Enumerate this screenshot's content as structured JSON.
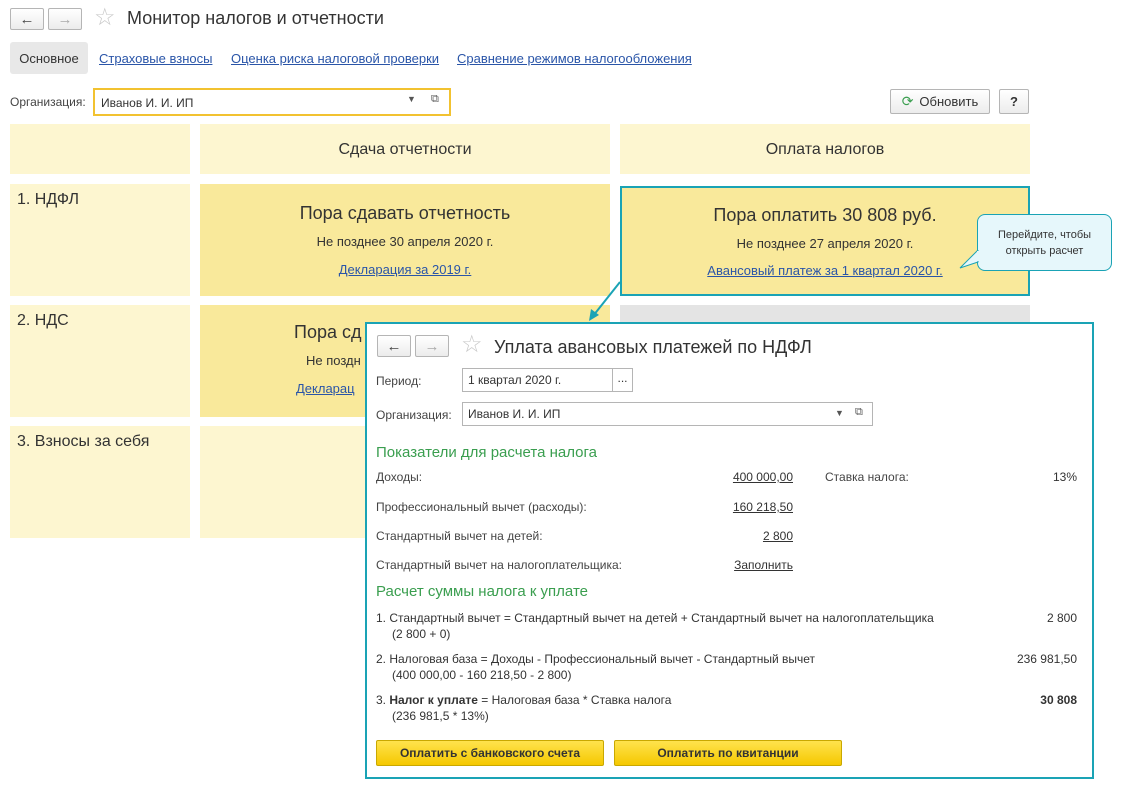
{
  "window": {
    "title": "Монитор налогов и отчетности"
  },
  "tabs": [
    {
      "label": "Основное"
    },
    {
      "label": "Страховые взносы"
    },
    {
      "label": "Оценка риска налоговой проверки"
    },
    {
      "label": "Сравнение режимов налогообложения"
    }
  ],
  "org": {
    "label": "Организация:",
    "value": "Иванов И. И. ИП"
  },
  "toolbar": {
    "refresh_label": "Обновить",
    "help_label": "?"
  },
  "columns": {
    "reporting": "Сдача отчетности",
    "payment": "Оплата налогов"
  },
  "rows": [
    {
      "label": "1. НДФЛ"
    },
    {
      "label": "2. НДС"
    },
    {
      "label": "3. Взносы за себя"
    }
  ],
  "ndfl_report": {
    "title": "Пора сдавать отчетность",
    "deadline": "Не позднее 30 апреля 2020 г.",
    "link": "Декларация за 2019 г."
  },
  "ndfl_pay": {
    "title": "Пора оплатить 30 808 руб.",
    "deadline": "Не позднее 27 апреля 2020 г.",
    "link": "Авансовый платеж за 1 квартал 2020 г."
  },
  "nds_report": {
    "title_partial": "Пора сд",
    "deadline_partial": "Не поздн",
    "link_partial": "Декларац"
  },
  "tooltip": {
    "text": "Перейдите, чтобы открыть расчет"
  },
  "popup": {
    "title": "Уплата авансовых платежей по НДФЛ",
    "period_label": "Период:",
    "period_value": "1 квартал 2020 г.",
    "period_btn": "...",
    "org_label": "Организация:",
    "org_value": "Иванов И. И. ИП",
    "section1": "Показатели для расчета налога",
    "income_label": "Доходы:",
    "income_value": "400 000,00",
    "rate_label": "Ставка налога:",
    "rate_value": "13%",
    "prof_label": "Профессиональный вычет (расходы):",
    "prof_value": "160 218,50",
    "child_label": "Стандартный вычет на детей:",
    "child_value": "2 800",
    "payer_label": "Стандартный вычет на налогоплательщика:",
    "payer_link": "Заполнить",
    "section2": "Расчет суммы налога к уплате",
    "calc": [
      {
        "line": "1. Стандартный вычет = Стандартный вычет на детей + Стандартный вычет на налогоплательщика",
        "detail": "(2 800 + 0)",
        "value": "2 800"
      },
      {
        "line": "2. Налоговая база = Доходы - Профессиональный вычет - Стандартный вычет",
        "detail": "(400 000,00 - 160 218,50 - 2 800)",
        "value": "236 981,50"
      },
      {
        "num": "3. ",
        "bold": "Налог к уплате",
        "rest": " = Налоговая база * Ставка налога",
        "detail": "(236 981,5 * 13%)",
        "value": "30 808"
      }
    ],
    "pay_bank_label": "Оплатить с банковского счета",
    "pay_receipt_label": "Оплатить по квитанции"
  },
  "colors": {
    "accent_green": "#3a9e4f",
    "link_blue": "#2a55a8",
    "highlight_teal": "#1aa3b5",
    "card_yellow": "#f9e99b",
    "cell_light": "#fdf6d0"
  }
}
